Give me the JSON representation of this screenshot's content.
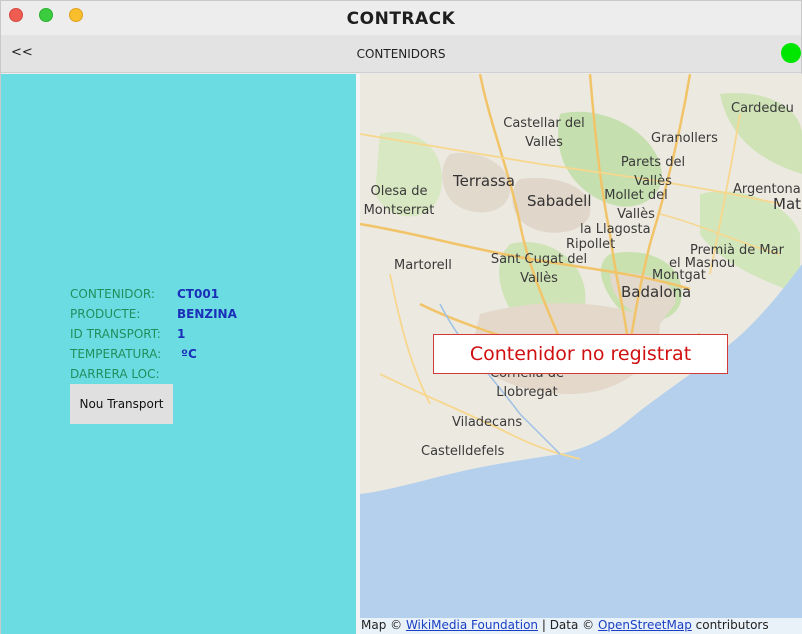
{
  "window": {
    "title": "CONTRACK"
  },
  "toolbar": {
    "back_label": "<<",
    "section_title": "CONTENIDORS",
    "status_color": "#00e600"
  },
  "colors": {
    "panel_bg": "#6cdce3",
    "label": "#1f8f5c",
    "value": "#1a2fb8",
    "popup_text": "#d01010",
    "sea": "#b5d0ec"
  },
  "details": {
    "rows": [
      {
        "label": "CONTENIDOR:",
        "value": "CT001"
      },
      {
        "label": "PRODUCTE:",
        "value": "BENZINA"
      },
      {
        "label": "ID TRANSPORT:",
        "value": "1"
      },
      {
        "label": "TEMPERATURA:",
        "value": " ºC"
      },
      {
        "label": "DARRERA LOC:",
        "value": ""
      }
    ],
    "button_label": "Nou Transport"
  },
  "map": {
    "places": {
      "castellar": "Castellar del\nVallès",
      "cardedeu": "Cardedeu",
      "granollers": "Granollers",
      "parets": "Parets del\nVallès",
      "mollet": "Mollet del\nVallès",
      "terrassa": "Terrassa",
      "sabadell": "Sabadell",
      "olesa": "Olesa de\nMontserrat",
      "argentona": "Argentona",
      "mat": "Mat",
      "lallagosta": "la Llagosta",
      "ripollet": "Ripollet",
      "martorell": "Martorell",
      "santcugat": "Sant Cugat del\nVallès",
      "premia": "Premià de Mar",
      "elmasnou": "el Masnou",
      "montgat": "Montgat",
      "badalona": "Badalona",
      "cornella": "Cornellà de\nLlobregat",
      "viladecans": "Viladecans",
      "castelldefels": "Castelldefels"
    },
    "popup_text": "Contenidor no registrat",
    "attribution": {
      "prefix": "Map © ",
      "link1": "WikiMedia Foundation",
      "middle": " | Data © ",
      "link2": "OpenStreetMap",
      "suffix": " contributors"
    }
  }
}
